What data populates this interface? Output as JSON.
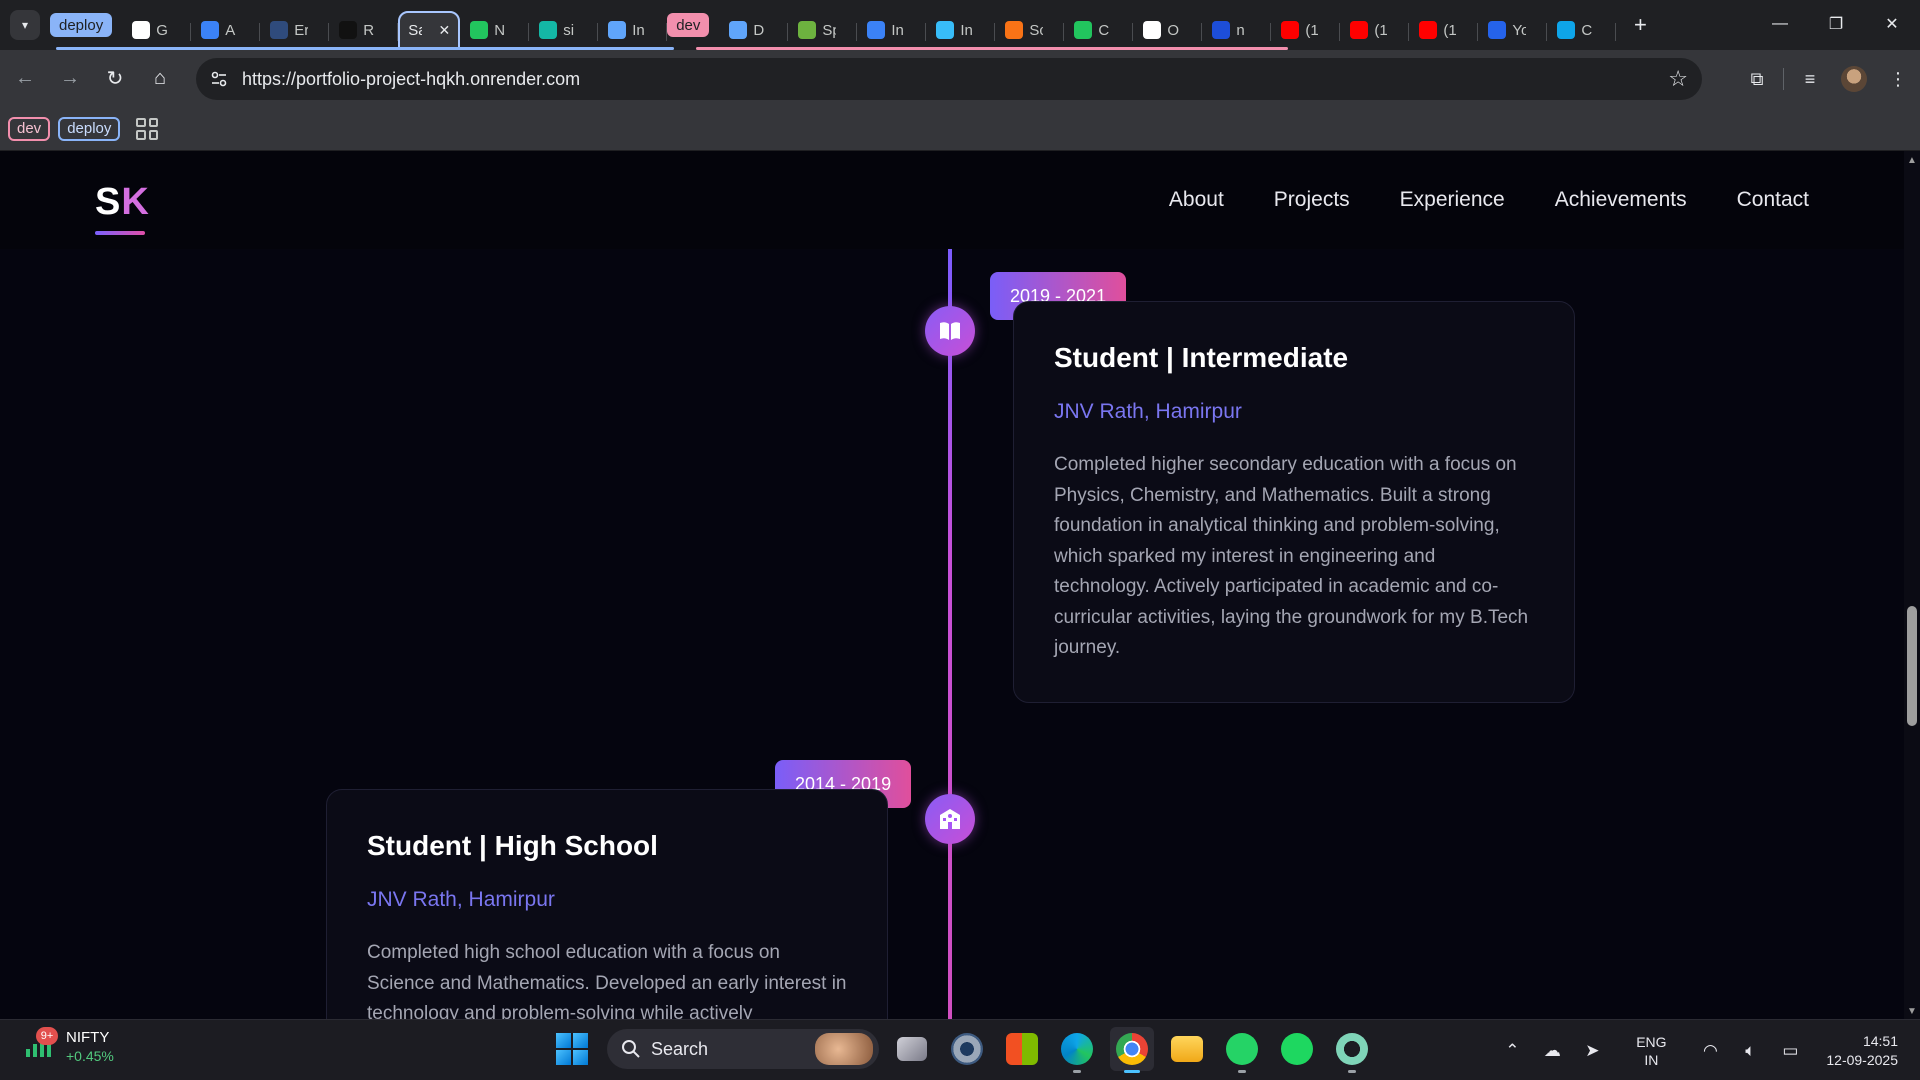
{
  "browser": {
    "tab_search_icon": "chevron-down-icon",
    "tabs": [
      {
        "group": "deploy",
        "label": "G",
        "favicon_color": "#ffffff",
        "icon": "github-icon"
      },
      {
        "group": "deploy",
        "label": "A",
        "favicon_color": "#3b82f6",
        "icon": "docker-icon"
      },
      {
        "group": "deploy",
        "label": "Er",
        "favicon_color": "#2f4b7c",
        "icon": "render-icon"
      },
      {
        "group": "deploy",
        "label": "R",
        "favicon_color": "#111111",
        "icon": "render-icon"
      },
      {
        "group": "deploy",
        "label": "Sa",
        "favicon_color": "",
        "icon": "none",
        "active": true
      },
      {
        "group": "deploy",
        "label": "N",
        "favicon_color": "#22c55e",
        "icon": "n-icon"
      },
      {
        "group": "deploy",
        "label": "si",
        "favicon_color": "#14b8a6",
        "icon": "diamond-icon"
      },
      {
        "group": "deploy",
        "label": "In",
        "favicon_color": "#60a5fa",
        "icon": "react-icon"
      },
      {
        "group": "dev",
        "label": "D",
        "favicon_color": "#60a5fa",
        "icon": "dotnet-icon"
      },
      {
        "group": "dev",
        "label": "Sp",
        "favicon_color": "#6db33f",
        "icon": "spring-icon"
      },
      {
        "group": "dev",
        "label": "In",
        "favicon_color": "#3b82f6",
        "icon": "mui-icon"
      },
      {
        "group": "dev",
        "label": "In",
        "favicon_color": "#38bdf8",
        "icon": "tailwind-icon"
      },
      {
        "group": "dev",
        "label": "Sc",
        "favicon_color": "#f97316",
        "icon": "colorful-icon"
      },
      {
        "group": "dev",
        "label": "C",
        "favicon_color": "#22c55e",
        "icon": "mongodb-leaf-icon"
      },
      {
        "group": "dev",
        "label": "O",
        "favicon_color": "#ffffff",
        "icon": "circle-icon"
      },
      {
        "group": "dev",
        "label": "n",
        "favicon_color": "#1d4ed8",
        "icon": "n-icon"
      },
      {
        "group": "",
        "label": "(1",
        "favicon_color": "#ff0000",
        "icon": "youtube-icon"
      },
      {
        "group": "",
        "label": "(1",
        "favicon_color": "#ff0000",
        "icon": "youtube-icon"
      },
      {
        "group": "",
        "label": "(1",
        "favicon_color": "#ff0000",
        "icon": "youtube-icon"
      },
      {
        "group": "",
        "label": "Yo",
        "favicon_color": "#2563eb",
        "icon": "s-icon"
      },
      {
        "group": "",
        "label": "C",
        "favicon_color": "#0ea5e9",
        "icon": "canva-icon"
      }
    ],
    "group_chip_deploy": "deploy",
    "group_chip_dev": "dev",
    "active_tab_close": "✕",
    "new_tab": "+",
    "window_minimize": "—",
    "window_restore": "❐",
    "window_close": "✕",
    "back": "←",
    "forward": "→",
    "reload": "↻",
    "home": "⌂",
    "url": "https://portfolio-project-hqkh.onrender.com",
    "bookmark_star": "☆",
    "bookmarks": {
      "dev": "dev",
      "deploy": "deploy"
    }
  },
  "site": {
    "logo_s": "S",
    "logo_k": "K",
    "nav": [
      "About",
      "Projects",
      "Experience",
      "Achievements",
      "Contact"
    ]
  },
  "timeline": [
    {
      "date": "2019 - 2021",
      "title": "Student | Intermediate",
      "org": "JNV Rath, Hamirpur",
      "description": "Completed higher secondary education with a focus on Physics, Chemistry, and Mathematics. Built a strong foundation in analytical thinking and problem-solving, which sparked my interest in engineering and technology. Actively participated in academic and co-curricular activities, laying the groundwork for my B.Tech journey.",
      "icon": "book-open-icon",
      "side": "right"
    },
    {
      "date": "2014 - 2019",
      "title": "Student | High School",
      "org": "JNV Rath, Hamirpur",
      "description": "Completed high school education with a focus on Science and Mathematics. Developed an early interest in technology and problem-solving while actively",
      "icon": "school-icon",
      "side": "left"
    }
  ],
  "taskbar": {
    "widget_title": "NIFTY",
    "widget_change": "+0.45%",
    "widget_badge": "9+",
    "search": "Search",
    "lang_1": "ENG",
    "lang_2": "IN",
    "time": "14:51",
    "date": "12-09-2025",
    "apps": [
      "task-view",
      "settings",
      "microsoft-store",
      "edge",
      "chrome",
      "file-explorer",
      "whatsapp",
      "spotify",
      "chatgpt"
    ]
  },
  "colors": {
    "accent_purple": "#7a5ef8",
    "accent_pink": "#e04f9c",
    "org_text": "#7a76f0",
    "group_deploy": "#8ab4f8",
    "group_dev": "#f28fad"
  }
}
